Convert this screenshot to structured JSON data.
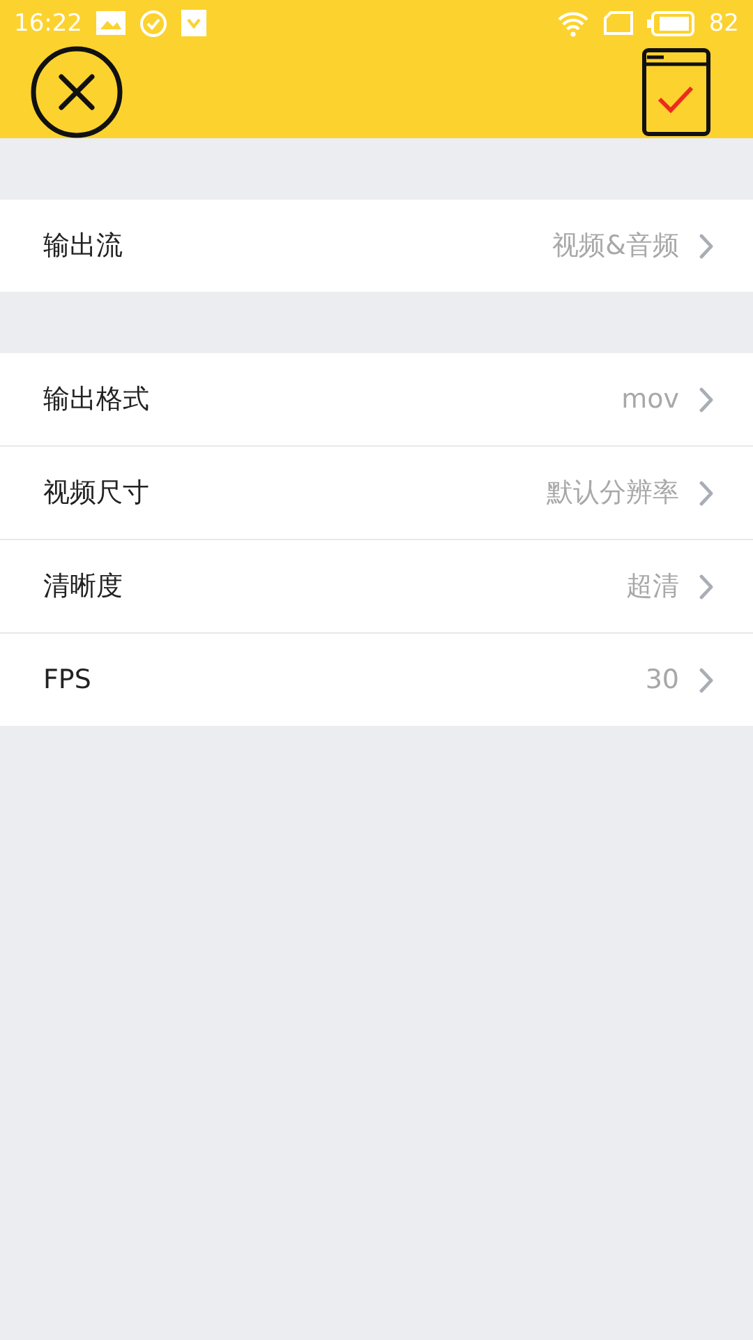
{
  "status_bar": {
    "time": "16:22",
    "battery": "82"
  },
  "sections": [
    {
      "rows": [
        {
          "label": "输出流",
          "value": "视频&音频"
        }
      ]
    },
    {
      "rows": [
        {
          "label": "输出格式",
          "value": "mov"
        },
        {
          "label": "视频尺寸",
          "value": "默认分辨率"
        },
        {
          "label": "清晰度",
          "value": "超清"
        },
        {
          "label": "FPS",
          "value": "30"
        }
      ]
    }
  ]
}
